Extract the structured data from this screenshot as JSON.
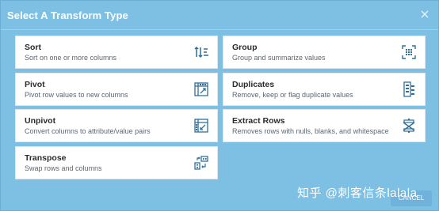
{
  "dialog": {
    "title": "Select A Transform Type",
    "cancel_label": "CANCEL"
  },
  "transforms": [
    {
      "name": "Sort",
      "desc": "Sort on one or more columns",
      "icon": "sort-icon"
    },
    {
      "name": "Group",
      "desc": "Group and summarize values",
      "icon": "group-icon"
    },
    {
      "name": "Pivot",
      "desc": "Pivot row values to new columns",
      "icon": "pivot-icon"
    },
    {
      "name": "Duplicates",
      "desc": "Remove, keep or flag duplicate values",
      "icon": "duplicates-icon"
    },
    {
      "name": "Unpivot",
      "desc": "Convert columns to attribute/value pairs",
      "icon": "unpivot-icon"
    },
    {
      "name": "Extract Rows",
      "desc": "Removes rows with nulls, blanks, and whitespace",
      "icon": "extract-rows-icon"
    },
    {
      "name": "Transpose",
      "desc": "Swap rows and columns",
      "icon": "transpose-icon"
    }
  ],
  "watermark": "知乎 @刺客信条lalala",
  "colors": {
    "dialog_bg": "#7ebfe4",
    "icon": "#2f6f99"
  }
}
